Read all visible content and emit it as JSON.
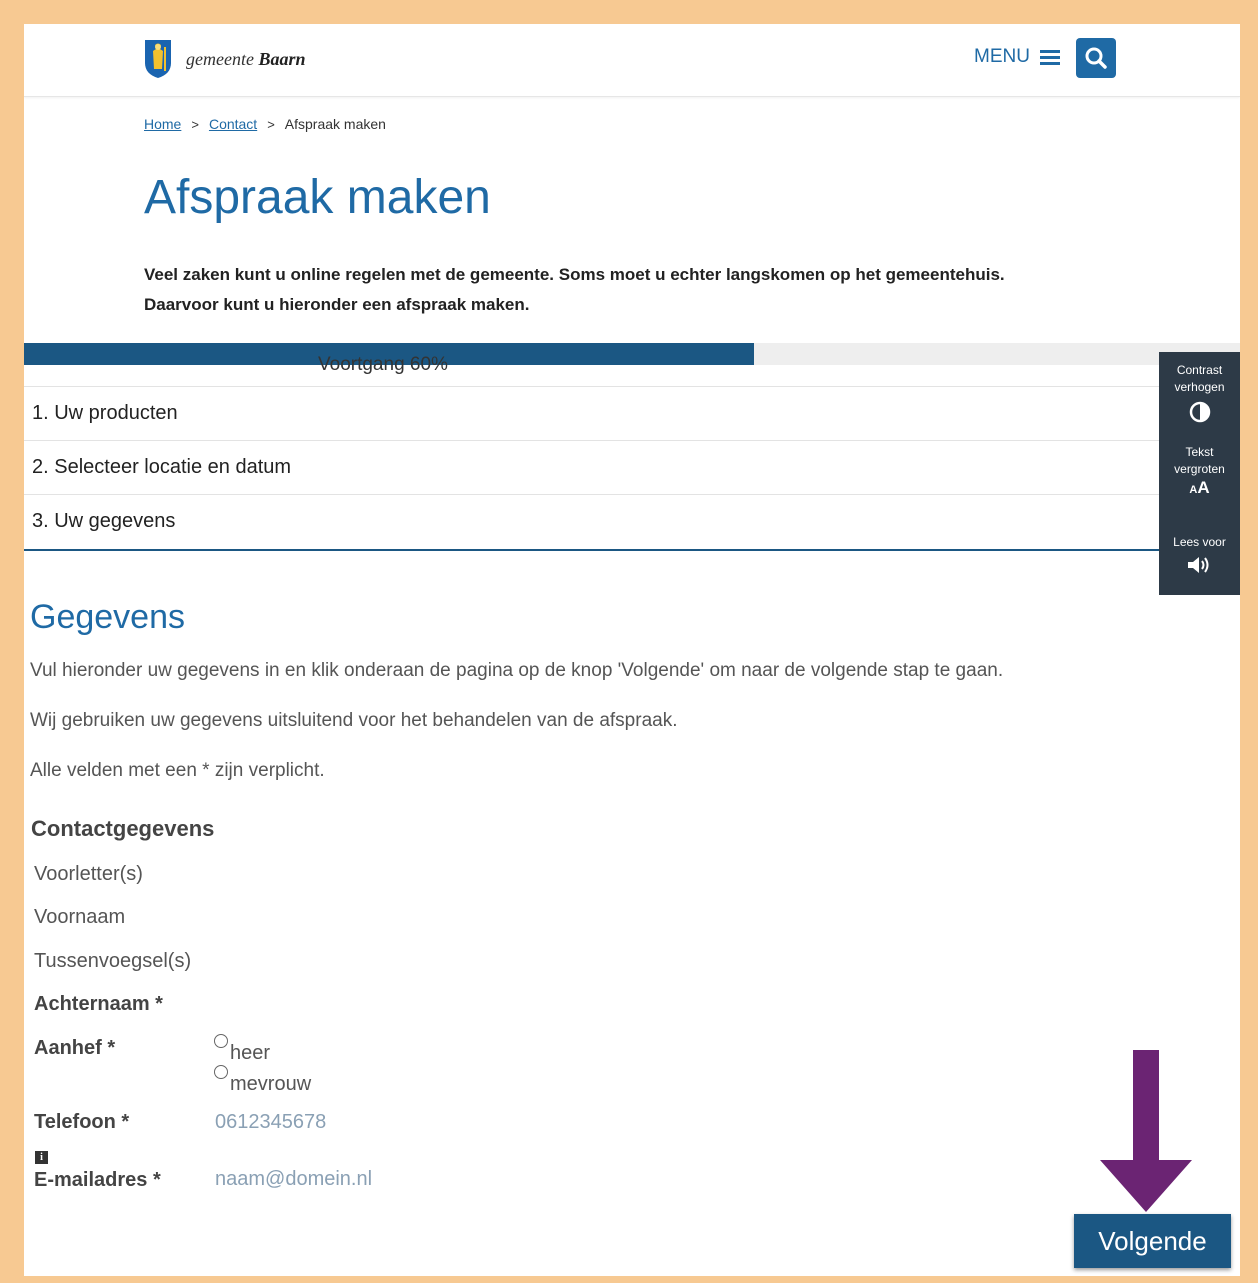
{
  "header": {
    "logo_text_light": "gemeente",
    "logo_text_bold": "Baarn",
    "menu_label": "MENU",
    "search_icon": "search-icon",
    "menu_icon": "hamburger-icon"
  },
  "breadcrumb": {
    "home": "Home",
    "contact": "Contact",
    "current": "Afspraak maken",
    "separator": ">"
  },
  "page": {
    "title": "Afspraak maken",
    "intro_line1": "Veel zaken kunt u online regelen met de gemeente. Soms moet u echter langskomen op het gemeentehuis.",
    "intro_line2": "Daarvoor kunt u hieronder een afspraak maken."
  },
  "progress": {
    "label": "Voortgang 60%",
    "value": 0.6,
    "fill_color": "#1b5783"
  },
  "steps": [
    {
      "label": "1. Uw producten"
    },
    {
      "label": "2. Selecteer locatie en datum"
    },
    {
      "label": "3. Uw gegevens"
    }
  ],
  "accessibility": {
    "contrast_line1": "Contrast",
    "contrast_line2": "verhogen",
    "text_line1": "Tekst",
    "text_line2": "vergroten",
    "text_icon": "AA",
    "read_label": "Lees voor"
  },
  "form": {
    "section_title": "Gegevens",
    "para1": "Vul hieronder uw gegevens in en klik onderaan de pagina op de knop 'Volgende' om naar de volgende stap te gaan.",
    "para2": "Wij gebruiken uw gegevens uitsluitend voor het behandelen van de afspraak.",
    "para3": "Alle velden met een * zijn verplicht.",
    "subsection_title": "Contactgegevens",
    "fields": {
      "initials": "Voorletter(s)",
      "firstname": "Voornaam",
      "infix": "Tussenvoegsel(s)",
      "lastname": "Achternaam *",
      "salutation": "Aanhef *",
      "phone": "Telefoon *",
      "email": "E-mailadres *"
    },
    "salutation_options": [
      "heer",
      "mevrouw"
    ],
    "phone_placeholder": "0612345678",
    "email_placeholder": "naam@domein.nl",
    "info_icon": "i"
  },
  "next_button": "Volgende",
  "colors": {
    "brand_blue": "#1f6aa5",
    "dark_blue": "#1b5783",
    "arrow_purple": "#6b2473",
    "frame_orange": "#f7c992"
  }
}
